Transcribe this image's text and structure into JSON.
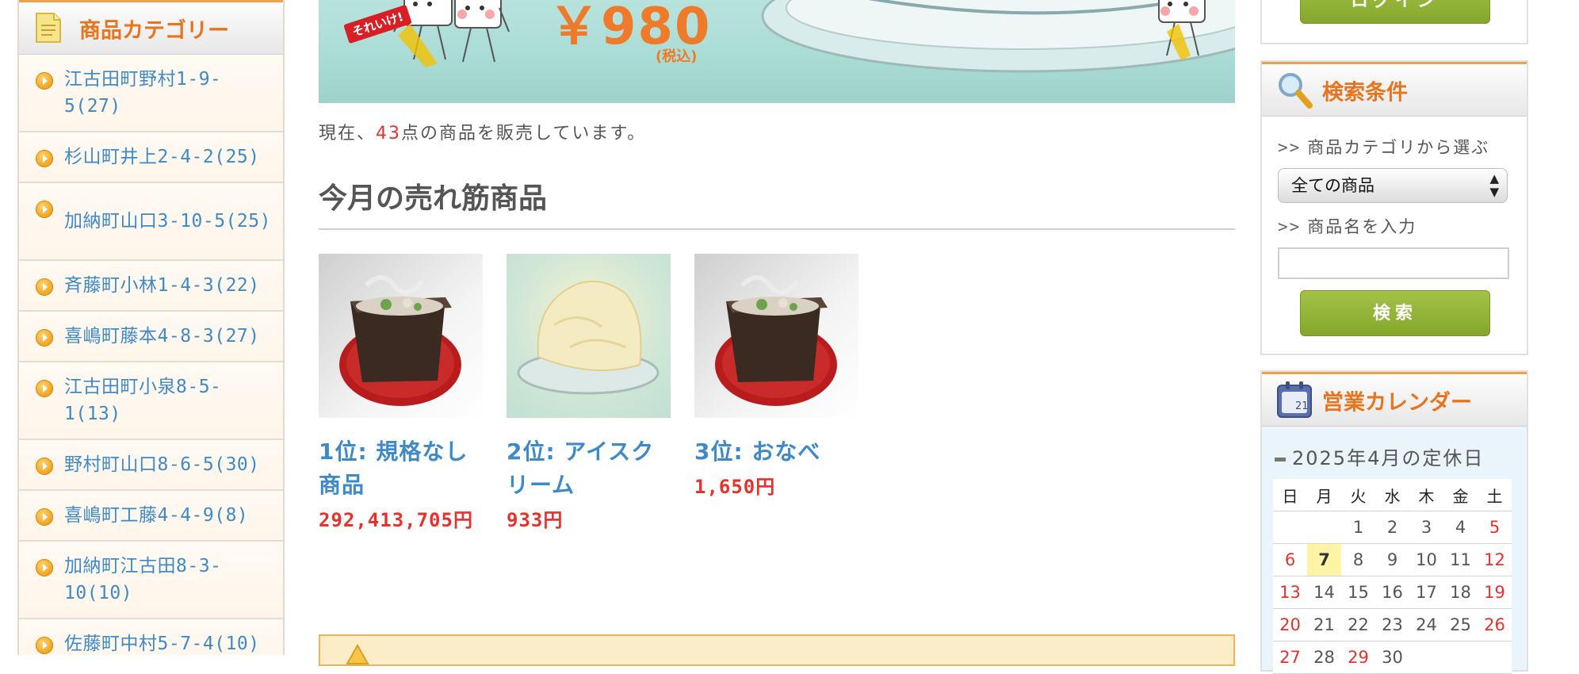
{
  "category_box": {
    "title": "商品カテゴリー",
    "items": [
      {
        "label": "江古田町野村1-9-5(27)"
      },
      {
        "label": "杉山町井上2-4-2(25)"
      },
      {
        "label": "加納町山口3-10-5(25)"
      },
      {
        "label": "斉藤町小林1-4-3(22)"
      },
      {
        "label": "喜嶋町藤本4-8-3(27)"
      },
      {
        "label": "江古田町小泉8-5-1(13)"
      },
      {
        "label": "野村町山口8-6-5(30)"
      },
      {
        "label": "喜嶋町工藤4-4-9(8)"
      },
      {
        "label": "加納町江古田8-3-10(10)"
      },
      {
        "label": "佐藤町中村5-7-4(10)"
      }
    ]
  },
  "banner": {
    "tag": "それいけ!",
    "price": "￥980",
    "tax_note": "(税込)"
  },
  "intro": {
    "prefix": "現在、",
    "count": "43",
    "suffix": "点の商品を販売しています。"
  },
  "ranking": {
    "title": "今月の売れ筋商品",
    "products": [
      {
        "name": "1位: 規格なし商品",
        "price": "292,413,705円",
        "image": "nabe-pot"
      },
      {
        "name": "2位: アイスクリーム",
        "price": "933円",
        "image": "ice-cream"
      },
      {
        "name": "3位: おなべ",
        "price": "1,650円",
        "image": "nabe-pot"
      }
    ]
  },
  "search_box": {
    "title": "検索条件",
    "category_label": "商品カテゴリから選ぶ",
    "category_value": "全ての商品",
    "name_label": "商品名を入力",
    "name_value": "",
    "button_label": "検索"
  },
  "top_right_button": {
    "label": "ログイン"
  },
  "calendar_box": {
    "title": "営業カレンダー",
    "caption": "2025年4月の定休日",
    "weekdays": [
      "日",
      "月",
      "火",
      "水",
      "木",
      "金",
      "土"
    ],
    "weeks": [
      [
        "",
        "",
        "1",
        "2",
        "3",
        "4",
        "5"
      ],
      [
        "6",
        "7",
        "8",
        "9",
        "10",
        "11",
        "12"
      ],
      [
        "13",
        "14",
        "15",
        "16",
        "17",
        "18",
        "19"
      ],
      [
        "20",
        "21",
        "22",
        "23",
        "24",
        "25",
        "26"
      ],
      [
        "27",
        "28",
        "29",
        "30",
        "",
        "",
        ""
      ]
    ],
    "holidays": [
      "5",
      "6",
      "12",
      "13",
      "19",
      "20",
      "26",
      "27",
      "29"
    ],
    "today": "7"
  },
  "colors": {
    "accent_orange": "#e8741e",
    "link_blue": "#3e8ac8",
    "price_red": "#e5322d",
    "button_green": "#8aad2f"
  }
}
